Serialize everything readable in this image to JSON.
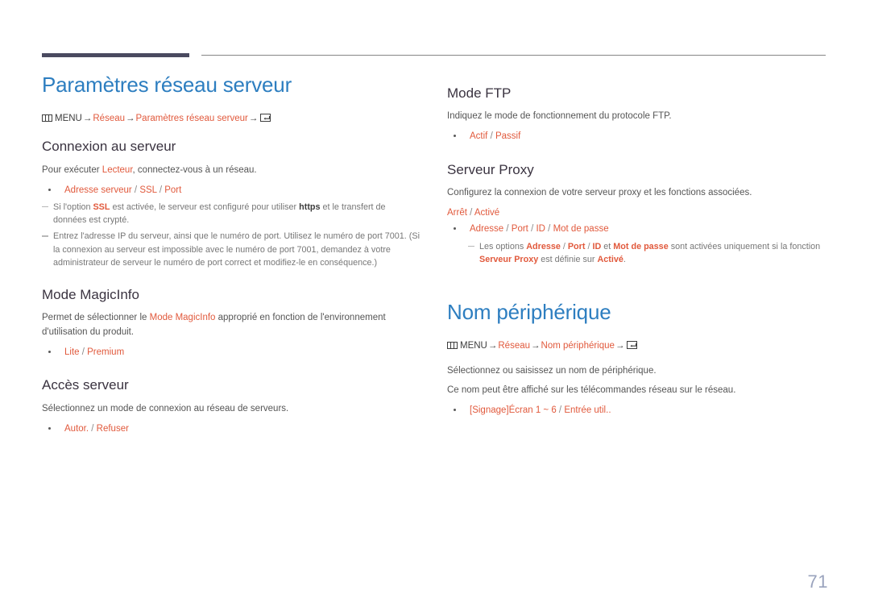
{
  "document": {
    "page_number": "71",
    "accent_color": "#e1593c",
    "heading_color": "#2d7ec0",
    "page_number_color": "#9aa3bd",
    "rule_dark_color": "#4a4a60"
  },
  "left_column": {
    "chapter_title": "Paramètres réseau serveur",
    "breadcrumb": {
      "menu_icon": "menu-grid-icon",
      "menu_label": "MENU",
      "arrow": "→",
      "item1": "Réseau",
      "item2": "Paramètres réseau serveur",
      "enter_icon": "enter-key-icon"
    },
    "sections": [
      {
        "heading": "Connexion au serveur",
        "intro_pre": "Pour exécuter ",
        "intro_accent": "Lecteur",
        "intro_post": ", connectez-vous à un réseau.",
        "options": {
          "o1": "Adresse serveur",
          "o2": "SSL",
          "o3": "Port"
        },
        "note1": {
          "a": "Si l'option ",
          "b": "SSL",
          "c": " est activée, le serveur est configuré pour utiliser ",
          "d": "https",
          "e": " et le transfert de données est crypté."
        },
        "note2": "Entrez l'adresse IP du serveur, ainsi que le numéro de port. Utilisez le numéro de port 7001. (Si la connexion au serveur est impossible avec le numéro de port 7001, demandez à votre administrateur de serveur le numéro de port correct et modifiez-le en conséquence.)"
      },
      {
        "heading": "Mode MagicInfo",
        "intro_pre": "Permet de sélectionner le ",
        "intro_accent": "Mode MagicInfo",
        "intro_post": " approprié en fonction de l'environnement d'utilisation du produit.",
        "options": {
          "o1": "Lite",
          "o2": "Premium"
        }
      },
      {
        "heading": "Accès serveur",
        "intro": "Sélectionnez un mode de connexion au réseau de serveurs.",
        "options": {
          "o1": "Autor.",
          "o2": "Refuser"
        }
      }
    ]
  },
  "right_column": {
    "sections": [
      {
        "heading": "Mode FTP",
        "intro": "Indiquez le mode de fonctionnement du protocole FTP.",
        "options": {
          "o1": "Actif",
          "o2": "Passif"
        }
      },
      {
        "heading": "Serveur Proxy",
        "intro": "Configurez la connexion de votre serveur proxy et les fonctions associées.",
        "plain_options": {
          "o1": "Arrêt",
          "o2": "Activé"
        },
        "options": {
          "o1": "Adresse",
          "o2": "Port",
          "o3": "ID",
          "o4": "Mot de passe"
        },
        "note": {
          "a": "Les options ",
          "b": "Adresse",
          "c": "Port",
          "d": "ID",
          "e": " et ",
          "f": "Mot de passe",
          "g": " sont activées uniquement si la fonction ",
          "h": "Serveur Proxy",
          "i": " est définie sur ",
          "j": "Activé",
          "k": "."
        }
      }
    ],
    "chapter_title": "Nom périphérique",
    "breadcrumb": {
      "menu_icon": "menu-grid-icon",
      "menu_label": "MENU",
      "arrow": "→",
      "item1": "Réseau",
      "item2": "Nom périphérique",
      "enter_icon": "enter-key-icon"
    },
    "device_name": {
      "line1": "Sélectionnez ou saisissez un nom de périphérique.",
      "line2": "Ce nom peut être affiché sur les télécommandes réseau sur le réseau.",
      "options": {
        "o1": "[Signage]Écran 1 ~ 6",
        "o2": "Entrée util."
      }
    }
  }
}
